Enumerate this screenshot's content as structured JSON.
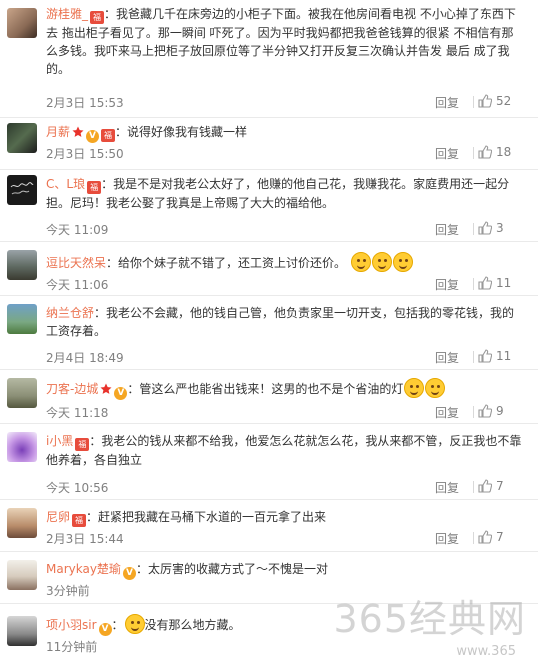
{
  "comments": [
    {
      "username": "游桂雅_",
      "text": "我爸藏几千在床旁边的小柜子下面。被我在他房间看电视 不小心掉了东西下去 拖出柜子看见了。那一瞬间 吓死了。因为平时我妈都把我爸爸钱算的很紧 不相信有那么多钱。我吓来马上把柜子放回原位等了半分钟又打开反复三次确认并告发 最后 成了我的。",
      "time": "2月3日 15:53",
      "reply": "回复",
      "likes": "52"
    },
    {
      "username": "月薪",
      "text": "说得好像我有钱藏一样",
      "time": "2月3日 15:50",
      "reply": "回复",
      "likes": "18"
    },
    {
      "username": "C、L琅",
      "text": "我是不是对我老公太好了，他赚的他自己花，我赚我花。家庭费用还一起分担。尼玛！我老公娶了我真是上帝赐了大大的福给他。",
      "time": "今天 11:09",
      "reply": "回复",
      "likes": "3"
    },
    {
      "username": "逗比天然呆",
      "text": "给你个妹子就不错了，还工资上讨价还价。",
      "time": "今天 11:06",
      "reply": "回复",
      "likes": "11"
    },
    {
      "username": "纳兰仓舒",
      "text": "我老公不会藏，他的钱自己管，他负责家里一切开支，包括我的零花钱，我的工资存着。",
      "time": "2月4日 18:49",
      "reply": "回复",
      "likes": "11"
    },
    {
      "username": "刀客-边城",
      "text": "管这么严也能省出钱来！这男的也不是个省油的灯",
      "time": "今天 11:18",
      "reply": "回复",
      "likes": "9"
    },
    {
      "username": "i小黑",
      "text": "我老公的钱从来都不给我，他爱怎么花就怎么花，我从来都不管，反正我也不靠他养着，各自独立",
      "time": "今天 10:56",
      "reply": "回复",
      "likes": "7"
    },
    {
      "username": "尼卵",
      "text": "赶紧把我藏在马桶下水道的一百元拿了出来",
      "time": "2月3日 15:44",
      "reply": "回复",
      "likes": "7"
    },
    {
      "username": "Marykay楚瑜",
      "text": "太厉害的收藏方式了～不愧是一对",
      "time": "3分钟前",
      "reply": "回复",
      "likes": ""
    },
    {
      "username": "项小羽sir",
      "text": "没有那么地方藏。",
      "time": "11分钟前",
      "reply": "回复",
      "likes": ""
    }
  ],
  "watermark": {
    "brand": "365经典网",
    "url": "www.365"
  },
  "colors": {
    "username": "#eb7350",
    "meta": "#808080",
    "text": "#333333"
  }
}
